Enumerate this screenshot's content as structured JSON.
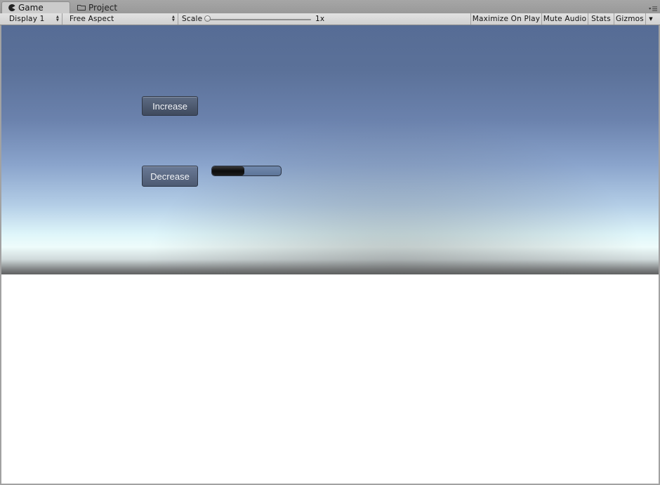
{
  "tabs": [
    {
      "label": "Game",
      "icon": "pacman-icon",
      "active": true
    },
    {
      "label": "Project",
      "icon": "folder-icon",
      "active": false
    }
  ],
  "toolbar": {
    "display": "Display 1",
    "aspect": "Free Aspect",
    "scale_label": "Scale",
    "scale_value": "1x",
    "maximize_on_play": "Maximize On Play",
    "mute_audio": "Mute Audio",
    "stats": "Stats",
    "gizmos": "Gizmos"
  },
  "game": {
    "increase_label": "Increase",
    "decrease_label": "Decrease",
    "progress": 0.47
  },
  "colors": {
    "sky_top": "#566c95",
    "horizon": "#eefcfb",
    "button": "#4a566c"
  }
}
